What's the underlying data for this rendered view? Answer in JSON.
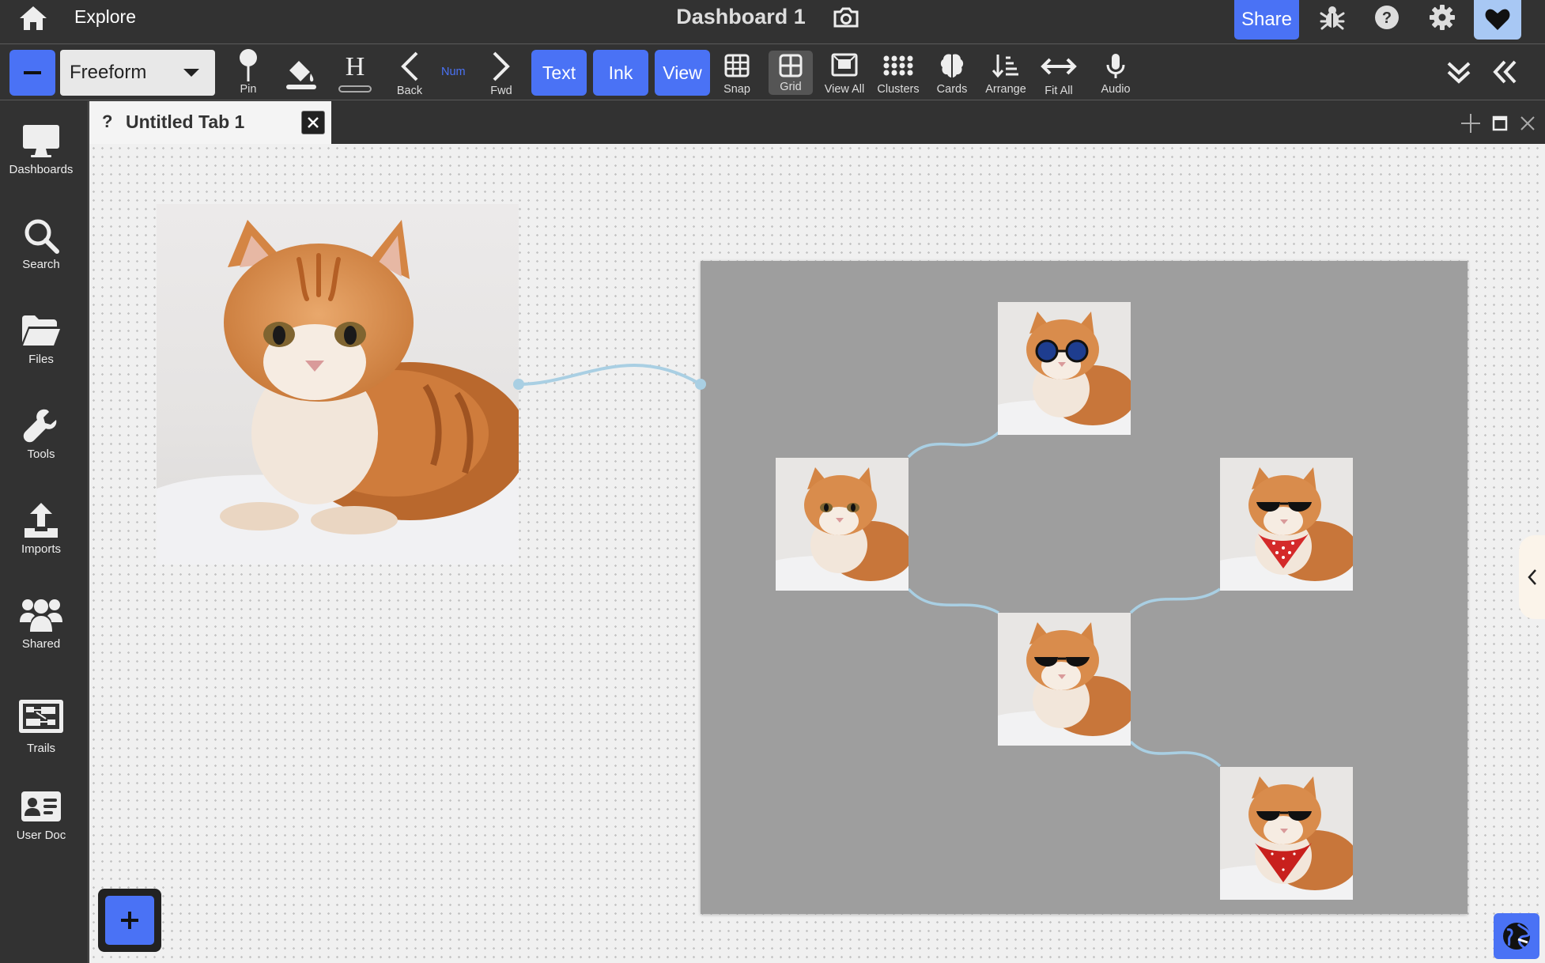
{
  "topbar": {
    "explore_label": "Explore",
    "dashboard_title": "Dashboard 1",
    "share_label": "Share",
    "icons": [
      "home-icon",
      "camera-icon",
      "bug-icon",
      "help-icon",
      "gear-icon",
      "heart-icon"
    ]
  },
  "toolbar": {
    "mode_value": "Freeform",
    "pin_label": "Pin",
    "back_label": "Back",
    "num_label": "Num",
    "fwd_label": "Fwd",
    "text_label": "Text",
    "ink_label": "Ink",
    "view_label": "View",
    "snap_label": "Snap",
    "grid_label": "Grid",
    "viewall_label": "View All",
    "clusters_label": "Clusters",
    "cards_label": "Cards",
    "arrange_label": "Arrange",
    "fitall_label": "Fit All",
    "audio_label": "Audio",
    "heading_glyph": "H"
  },
  "sidebar": {
    "items": [
      {
        "label": "Dashboards",
        "icon": "monitor-icon"
      },
      {
        "label": "Search",
        "icon": "search-icon"
      },
      {
        "label": "Files",
        "icon": "folder-icon"
      },
      {
        "label": "Tools",
        "icon": "wrench-icon"
      },
      {
        "label": "Imports",
        "icon": "upload-icon"
      },
      {
        "label": "Shared",
        "icon": "users-icon"
      },
      {
        "label": "Trails",
        "icon": "trails-icon"
      },
      {
        "label": "User Doc",
        "icon": "id-card-icon"
      }
    ]
  },
  "tab": {
    "indicator": "?",
    "title": "Untitled Tab 1"
  },
  "canvas": {
    "images": [
      "orange tabby cat lying on white bedding",
      "cat with round blue sunglasses",
      "plain tabby cat",
      "cat with black sunglasses and red polka-dot bandana",
      "cat with black sunglasses",
      "cat with black sunglasses and red bandana"
    ]
  },
  "colors": {
    "accent": "#4a72f5",
    "bar": "#323232",
    "canvas": "#f0f0f0",
    "collection": "#9e9e9e",
    "link": "#a9cfe3",
    "heart_bg": "#a8c8f4"
  }
}
